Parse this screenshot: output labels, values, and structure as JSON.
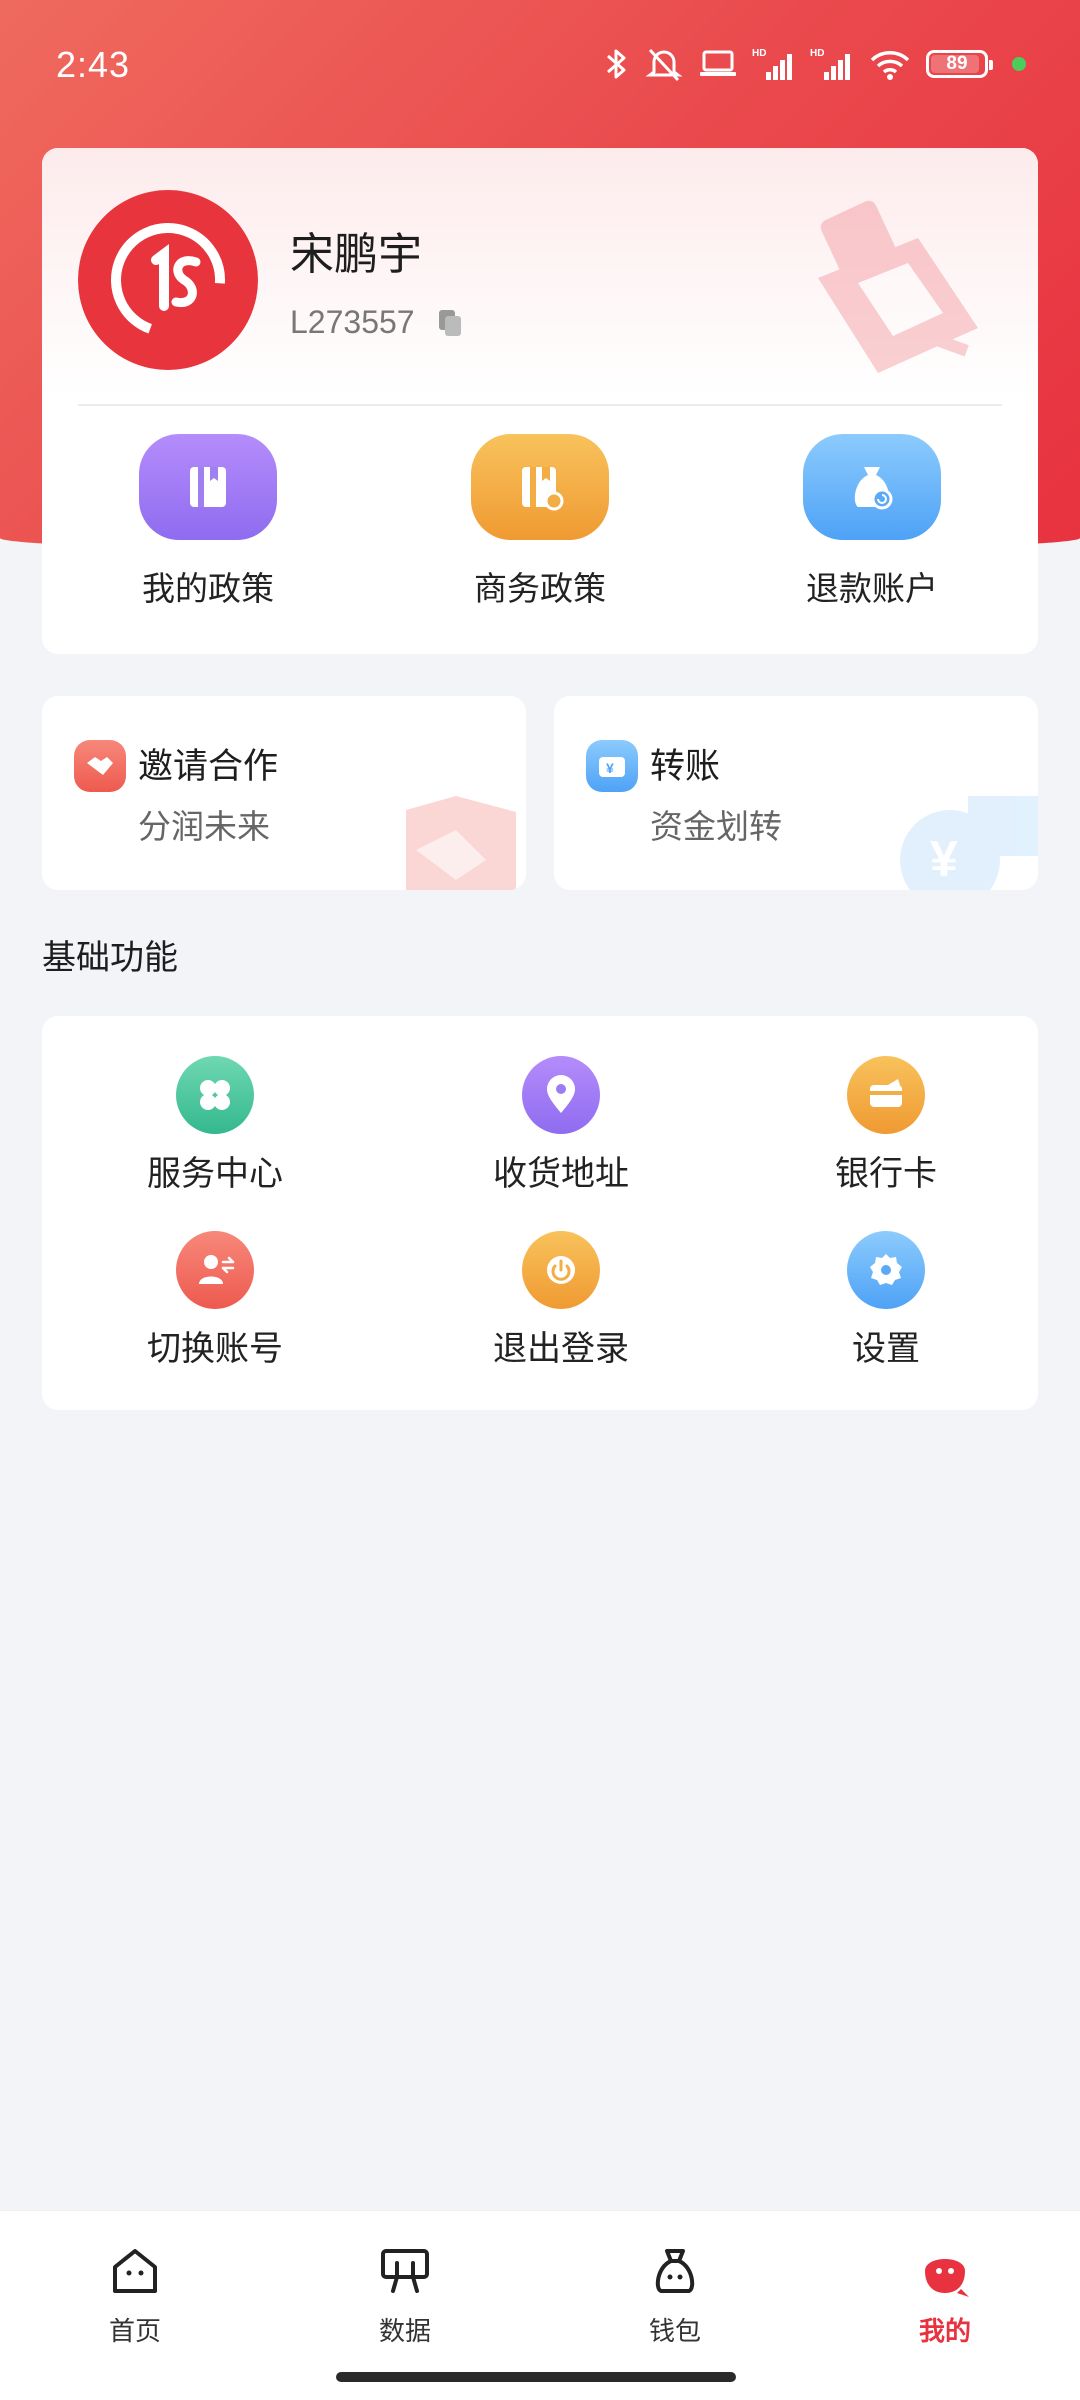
{
  "status_bar": {
    "time": "2:43",
    "battery": "89"
  },
  "profile": {
    "name": "宋鹏宇",
    "id": "L273557",
    "quick_actions": [
      {
        "label": "我的政策",
        "icon": "policy-book-icon",
        "color": "#9b7cf4"
      },
      {
        "label": "商务政策",
        "icon": "business-book-icon",
        "color": "#f2a83e"
      },
      {
        "label": "退款账户",
        "icon": "refund-bag-icon",
        "color": "#5aaaf8"
      }
    ]
  },
  "promos": {
    "invite": {
      "title": "邀请合作",
      "subtitle": "分润未来",
      "icon": "handshake-icon"
    },
    "transfer": {
      "title": "转账",
      "subtitle": "资金划转",
      "icon": "yuan-card-icon"
    }
  },
  "basic": {
    "title": "基础功能",
    "items": [
      {
        "label": "服务中心",
        "icon": "service-grid-icon",
        "color": "#3fc39a"
      },
      {
        "label": "收货地址",
        "icon": "location-pin-icon",
        "color": "#9b7cf4"
      },
      {
        "label": "银行卡",
        "icon": "bank-card-icon",
        "color": "#f2a83e"
      },
      {
        "label": "切换账号",
        "icon": "switch-user-icon",
        "color": "#f06a58"
      },
      {
        "label": "退出登录",
        "icon": "power-icon",
        "color": "#f2a83e"
      },
      {
        "label": "设置",
        "icon": "settings-gear-icon",
        "color": "#5aaaf8"
      }
    ]
  },
  "nav": {
    "items": [
      {
        "label": "首页",
        "icon": "home-icon",
        "active": false
      },
      {
        "label": "数据",
        "icon": "data-board-icon",
        "active": false
      },
      {
        "label": "钱包",
        "icon": "wallet-bag-icon",
        "active": false
      },
      {
        "label": "我的",
        "icon": "profile-mascot-icon",
        "active": true
      }
    ],
    "active_color": "#e8323f"
  }
}
